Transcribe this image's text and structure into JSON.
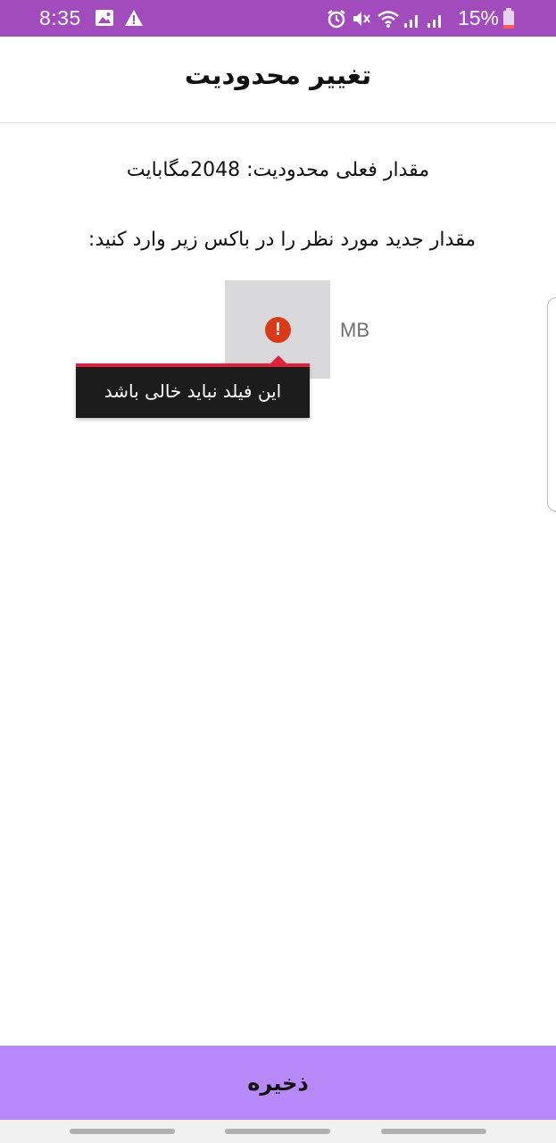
{
  "status_bar": {
    "time": "8:35",
    "battery_percent": "15%",
    "icons": [
      "image-icon",
      "warning-icon",
      "alarm-icon",
      "mute-icon",
      "wifi-icon",
      "signal-icon",
      "signal-icon",
      "battery-icon"
    ],
    "background_color": "#a24bbd"
  },
  "header": {
    "title": "تغییر محدودیت"
  },
  "main": {
    "current_limit_text": "مقدار فعلی محدودیت: 2048مگابایت",
    "instruction_text": "مقدار جدید مورد نظر را در باکس زیر وارد کنید:",
    "input": {
      "value": "",
      "unit": "MB",
      "error_icon": "error-icon"
    },
    "error_tooltip": {
      "text": "این فیلد نباید خالی باشد",
      "accent_color": "#e0203c"
    }
  },
  "footer": {
    "save_label": "ذخیره",
    "button_color": "#b889f9"
  }
}
